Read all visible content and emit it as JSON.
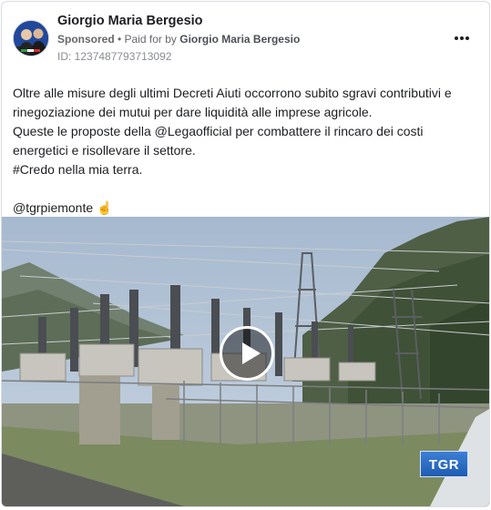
{
  "post": {
    "author": "Giorgio Maria Bergesio",
    "sponsored": "Sponsored",
    "paid_for_prefix": " • Paid for by ",
    "payer": "Giorgio Maria Bergesio",
    "ad_id": "ID: 1237487793713092",
    "lines": [
      "Oltre alle misure degli ultimi Decreti Aiuti occorrono subito sgravi contributivi e",
      "rinegoziazione dei mutui per dare liquidità alle imprese agricole.",
      "Queste le proposte della @Legaofficial per combattere il rincaro dei costi",
      "energetici e risollevare il settore.",
      "#Credo nella mia terra."
    ],
    "mention": "@tgrpiemonte ☝️"
  },
  "media": {
    "watermark": "TGR"
  },
  "icons": {
    "avatar": "profile-photo",
    "more": "more-horizontal-icon",
    "play": "play-icon"
  }
}
